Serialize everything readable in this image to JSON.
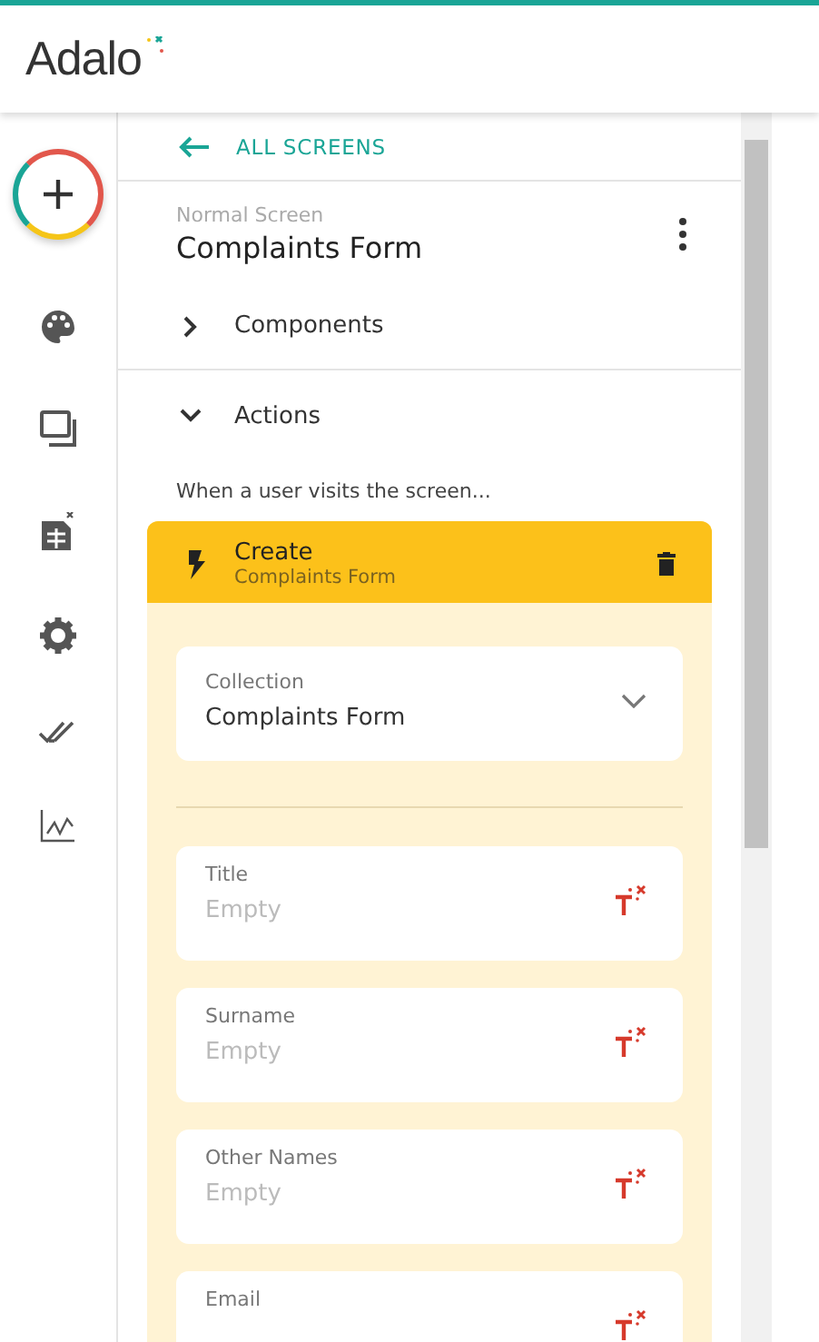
{
  "logo": "Adalo",
  "rail": [
    {
      "kind": "palette"
    },
    {
      "kind": "screens"
    },
    {
      "kind": "database"
    },
    {
      "kind": "settings"
    },
    {
      "kind": "publish"
    },
    {
      "kind": "analytics"
    }
  ],
  "back_link": "ALL SCREENS",
  "screen": {
    "type": "Normal Screen",
    "name": "Complaints Form"
  },
  "sections": [
    {
      "label": "Components",
      "expanded": false
    },
    {
      "label": "Actions",
      "expanded": true
    }
  ],
  "trigger_text": "When a user visits the screen...",
  "action": {
    "title": "Create",
    "subtitle": "Complaints Form",
    "fields": [
      {
        "kind": "dropdown",
        "label": "Collection",
        "value": "Complaints Form"
      },
      {
        "kind": "divider"
      },
      {
        "kind": "text",
        "label": "Title",
        "placeholder": "Empty"
      },
      {
        "kind": "text",
        "label": "Surname",
        "placeholder": "Empty"
      },
      {
        "kind": "text",
        "label": "Other Names",
        "placeholder": "Empty"
      },
      {
        "kind": "text",
        "label": "Email"
      }
    ]
  }
}
